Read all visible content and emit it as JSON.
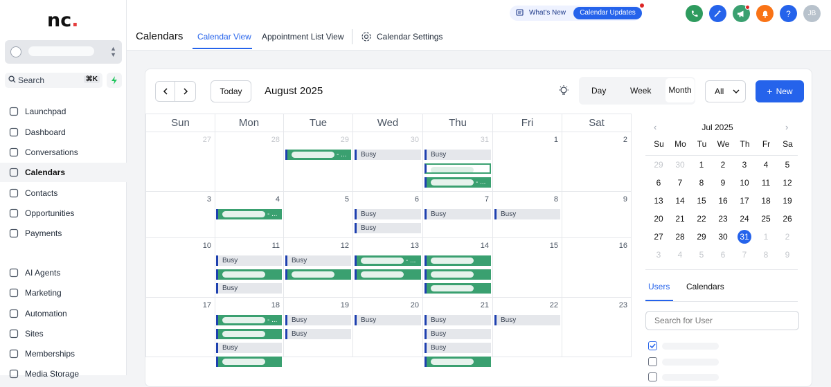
{
  "sidebar": {
    "logo_main": "nc",
    "logo_dot": ".",
    "search_label": "Search",
    "search_shortcut": "⌘K",
    "items": [
      {
        "label": "Launchpad",
        "icon": "rocket-icon"
      },
      {
        "label": "Dashboard",
        "icon": "grid-icon"
      },
      {
        "label": "Conversations",
        "icon": "chat-icon"
      },
      {
        "label": "Calendars",
        "icon": "calendar-icon",
        "active": true
      },
      {
        "label": "Contacts",
        "icon": "contacts-icon"
      },
      {
        "label": "Opportunities",
        "icon": "pipeline-icon"
      },
      {
        "label": "Payments",
        "icon": "receipt-icon"
      },
      {
        "label": "AI Agents",
        "icon": "sparkle-icon"
      },
      {
        "label": "Marketing",
        "icon": "send-icon"
      },
      {
        "label": "Automation",
        "icon": "play-icon"
      },
      {
        "label": "Sites",
        "icon": "sites-icon"
      },
      {
        "label": "Memberships",
        "icon": "award-icon"
      },
      {
        "label": "Media Storage",
        "icon": "storage-icon"
      }
    ]
  },
  "header": {
    "page_title": "Calendars",
    "tabs": [
      {
        "label": "Calendar View",
        "active": true
      },
      {
        "label": "Appointment List View"
      },
      {
        "label": "Calendar Settings"
      }
    ],
    "whats_new": "What's New",
    "updates_pill": "Calendar Updates",
    "user_initials": "JB",
    "help": "?",
    "colors": {
      "phone": "#2e9b5e",
      "magic": "#2563eb",
      "announce": "#3aa070",
      "bell": "#f97316",
      "help": "#2563eb",
      "avatar": "#b8c2cc"
    }
  },
  "toolbar": {
    "today": "Today",
    "month_title": "August 2025",
    "views": [
      "Day",
      "Week",
      "Month"
    ],
    "active_view": "Month",
    "filter": "All",
    "new_button": "New"
  },
  "calendar": {
    "weekdays": [
      "Sun",
      "Mon",
      "Tue",
      "Wed",
      "Thu",
      "Fri",
      "Sat"
    ],
    "weeks": [
      [
        {
          "n": "27",
          "m": true
        },
        {
          "n": "28",
          "m": true
        },
        {
          "n": "29",
          "m": true
        },
        {
          "n": "30",
          "m": true
        },
        {
          "n": "31",
          "m": true
        },
        {
          "n": "1"
        },
        {
          "n": "2"
        }
      ],
      [
        {
          "n": "3"
        },
        {
          "n": "4"
        },
        {
          "n": "5"
        },
        {
          "n": "6"
        },
        {
          "n": "7"
        },
        {
          "n": "8"
        },
        {
          "n": "9"
        }
      ],
      [
        {
          "n": "10"
        },
        {
          "n": "11"
        },
        {
          "n": "12"
        },
        {
          "n": "13"
        },
        {
          "n": "14"
        },
        {
          "n": "15"
        },
        {
          "n": "16"
        }
      ],
      [
        {
          "n": "17"
        },
        {
          "n": "18"
        },
        {
          "n": "19"
        },
        {
          "n": "20"
        },
        {
          "n": "21"
        },
        {
          "n": "22"
        },
        {
          "n": "23"
        }
      ]
    ],
    "busy_label": "Busy",
    "green_suffix": "- ...",
    "events": [
      {
        "week": 0,
        "day": 2,
        "slot": 0,
        "type": "green"
      },
      {
        "week": 0,
        "day": 3,
        "slot": 0,
        "type": "busy"
      },
      {
        "week": 0,
        "day": 4,
        "slot": 0,
        "type": "busy"
      },
      {
        "week": 0,
        "day": 4,
        "slot": 1,
        "type": "outline"
      },
      {
        "week": 0,
        "day": 4,
        "slot": 2,
        "type": "green"
      },
      {
        "week": 1,
        "day": 1,
        "slot": 0,
        "type": "green"
      },
      {
        "week": 1,
        "day": 3,
        "slot": 0,
        "type": "busy"
      },
      {
        "week": 1,
        "day": 3,
        "slot": 1,
        "type": "busy"
      },
      {
        "week": 1,
        "day": 4,
        "slot": 0,
        "type": "busy"
      },
      {
        "week": 1,
        "day": 5,
        "slot": 0,
        "type": "busy"
      },
      {
        "week": 2,
        "day": 1,
        "slot": 0,
        "type": "busy"
      },
      {
        "week": 2,
        "day": 1,
        "slot": 1,
        "type": "greenplain"
      },
      {
        "week": 2,
        "day": 1,
        "slot": 2,
        "type": "busy"
      },
      {
        "week": 2,
        "day": 2,
        "slot": 0,
        "type": "busy"
      },
      {
        "week": 2,
        "day": 2,
        "slot": 1,
        "type": "greenplain"
      },
      {
        "week": 2,
        "day": 3,
        "slot": 0,
        "type": "green"
      },
      {
        "week": 2,
        "day": 3,
        "slot": 1,
        "type": "greenplain"
      },
      {
        "week": 2,
        "day": 4,
        "slot": 0,
        "type": "greenplain"
      },
      {
        "week": 2,
        "day": 4,
        "slot": 1,
        "type": "greenplain"
      },
      {
        "week": 2,
        "day": 4,
        "slot": 2,
        "type": "greenplain"
      },
      {
        "week": 3,
        "day": 1,
        "slot": 0,
        "type": "green"
      },
      {
        "week": 3,
        "day": 1,
        "slot": 1,
        "type": "greenplain"
      },
      {
        "week": 3,
        "day": 1,
        "slot": 2,
        "type": "busy"
      },
      {
        "week": 3,
        "day": 1,
        "slot": 3,
        "type": "greenplain"
      },
      {
        "week": 3,
        "day": 2,
        "slot": 0,
        "type": "busy"
      },
      {
        "week": 3,
        "day": 2,
        "slot": 1,
        "type": "busy"
      },
      {
        "week": 3,
        "day": 3,
        "slot": 0,
        "type": "busy"
      },
      {
        "week": 3,
        "day": 4,
        "slot": 0,
        "type": "busy"
      },
      {
        "week": 3,
        "day": 4,
        "slot": 1,
        "type": "busy"
      },
      {
        "week": 3,
        "day": 4,
        "slot": 2,
        "type": "busy"
      },
      {
        "week": 3,
        "day": 4,
        "slot": 3,
        "type": "greenplain"
      },
      {
        "week": 3,
        "day": 5,
        "slot": 0,
        "type": "busy"
      }
    ]
  },
  "minical": {
    "title": "Jul 2025",
    "dow": [
      "Su",
      "Mo",
      "Tu",
      "We",
      "Th",
      "Fr",
      "Sa"
    ],
    "weeks": [
      [
        {
          "n": "29",
          "m": true
        },
        {
          "n": "30",
          "m": true
        },
        {
          "n": "1"
        },
        {
          "n": "2"
        },
        {
          "n": "3"
        },
        {
          "n": "4"
        },
        {
          "n": "5"
        }
      ],
      [
        {
          "n": "6"
        },
        {
          "n": "7"
        },
        {
          "n": "8"
        },
        {
          "n": "9"
        },
        {
          "n": "10"
        },
        {
          "n": "11"
        },
        {
          "n": "12"
        }
      ],
      [
        {
          "n": "13"
        },
        {
          "n": "14"
        },
        {
          "n": "15"
        },
        {
          "n": "16"
        },
        {
          "n": "17"
        },
        {
          "n": "18"
        },
        {
          "n": "19"
        }
      ],
      [
        {
          "n": "20"
        },
        {
          "n": "21"
        },
        {
          "n": "22"
        },
        {
          "n": "23"
        },
        {
          "n": "24"
        },
        {
          "n": "25"
        },
        {
          "n": "26"
        }
      ],
      [
        {
          "n": "27"
        },
        {
          "n": "28"
        },
        {
          "n": "29"
        },
        {
          "n": "30"
        },
        {
          "n": "31",
          "sel": true
        },
        {
          "n": "1",
          "m": true
        },
        {
          "n": "2",
          "m": true
        }
      ],
      [
        {
          "n": "3",
          "m": true
        },
        {
          "n": "4",
          "m": true
        },
        {
          "n": "5",
          "m": true
        },
        {
          "n": "6",
          "m": true
        },
        {
          "n": "7",
          "m": true
        },
        {
          "n": "8",
          "m": true
        },
        {
          "n": "9",
          "m": true
        }
      ]
    ],
    "tabs": [
      "Users",
      "Calendars"
    ],
    "search_placeholder": "Search for User"
  }
}
